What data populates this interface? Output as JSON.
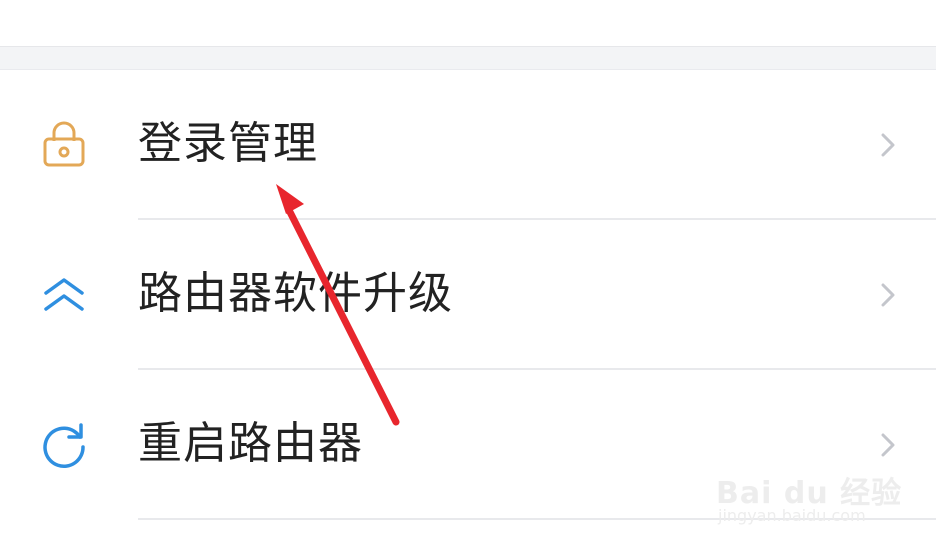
{
  "menu": {
    "items": [
      {
        "label": "登录管理",
        "icon": "lock-icon",
        "icon_color": "#e3a857"
      },
      {
        "label": "路由器软件升级",
        "icon": "double-chevron-up-icon",
        "icon_color": "#2f8fe0"
      },
      {
        "label": "重启路由器",
        "icon": "refresh-icon",
        "icon_color": "#2f8fe0"
      }
    ],
    "chevron_color": "#c4c6cc"
  },
  "annotation": {
    "arrow_color": "#e8262d"
  },
  "watermark": {
    "logo": "Bai du 经验",
    "url": "jingyan.baidu.com"
  }
}
